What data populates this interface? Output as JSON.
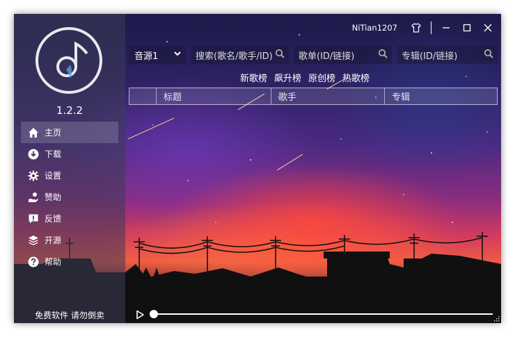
{
  "app": {
    "version": "1.2.2",
    "footer_text": "免费软件 请勿倒卖"
  },
  "titlebar": {
    "username": "NiTian1207",
    "icons": [
      "shirt-icon",
      "minimize-icon",
      "maximize-icon",
      "close-icon"
    ]
  },
  "sidebar": {
    "items": [
      {
        "label": "主页",
        "icon": "home-icon",
        "active": true
      },
      {
        "label": "下载",
        "icon": "download-icon",
        "active": false
      },
      {
        "label": "设置",
        "icon": "gear-icon",
        "active": false
      },
      {
        "label": "赞助",
        "icon": "donate-icon",
        "active": false
      },
      {
        "label": "反馈",
        "icon": "feedback-icon",
        "active": false
      },
      {
        "label": "开源",
        "icon": "layers-icon",
        "active": false
      },
      {
        "label": "帮助",
        "icon": "help-icon",
        "active": false
      }
    ]
  },
  "search": {
    "source_value": "音源1",
    "song_placeholder": "搜索(歌名/歌手/ID)",
    "playlist_placeholder": "歌单(ID/链接)",
    "album_placeholder": "专辑(ID/链接)"
  },
  "charts_tabs": [
    "新歌榜",
    "飙升榜",
    "原创榜",
    "热歌榜"
  ],
  "table": {
    "columns": [
      "标题",
      "歌手",
      "专辑"
    ]
  },
  "player": {
    "progress": 0
  },
  "colors": {
    "text": "#ffffff",
    "sidebar_bg": "#3c3c55"
  }
}
